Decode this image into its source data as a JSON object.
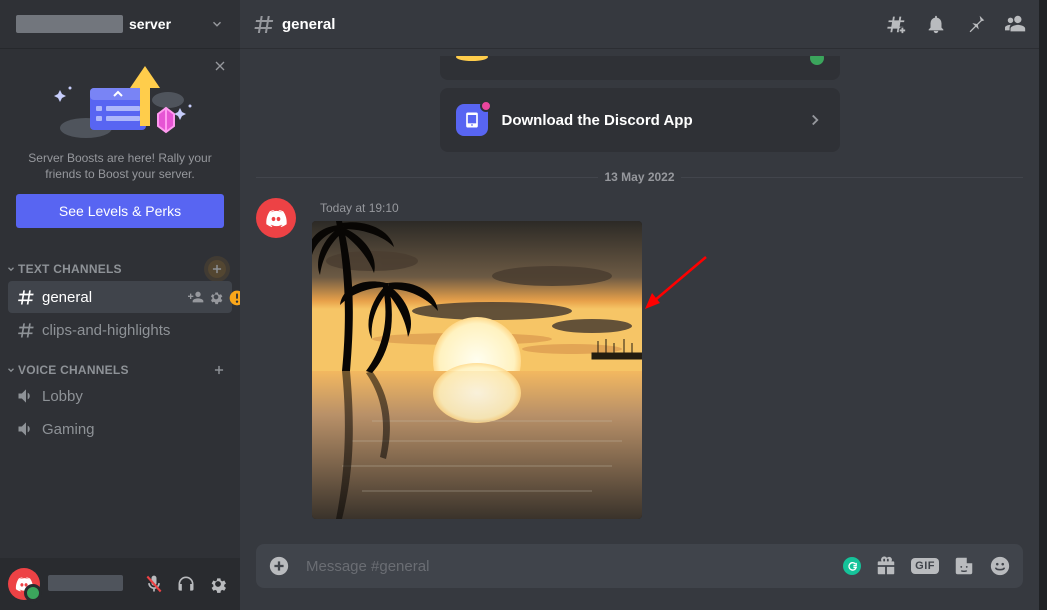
{
  "server": {
    "name_suffix": "server"
  },
  "promo": {
    "text": "Server Boosts are here! Rally your friends to Boost your server.",
    "button": "See Levels & Perks"
  },
  "sections": {
    "text_label": "Text Channels",
    "voice_label": "Voice Channels"
  },
  "text_channels": [
    {
      "name": "general",
      "selected": true
    },
    {
      "name": "clips-and-highlights",
      "selected": false
    }
  ],
  "voice_channels": [
    {
      "name": "Lobby"
    },
    {
      "name": "Gaming"
    }
  ],
  "topbar": {
    "channel": "general"
  },
  "cards": {
    "download": "Download the Discord App"
  },
  "divider_date": "13 May 2022",
  "message": {
    "timestamp": "Today at 19:10"
  },
  "composer": {
    "placeholder": "Message #general",
    "gif_label": "GIF"
  }
}
